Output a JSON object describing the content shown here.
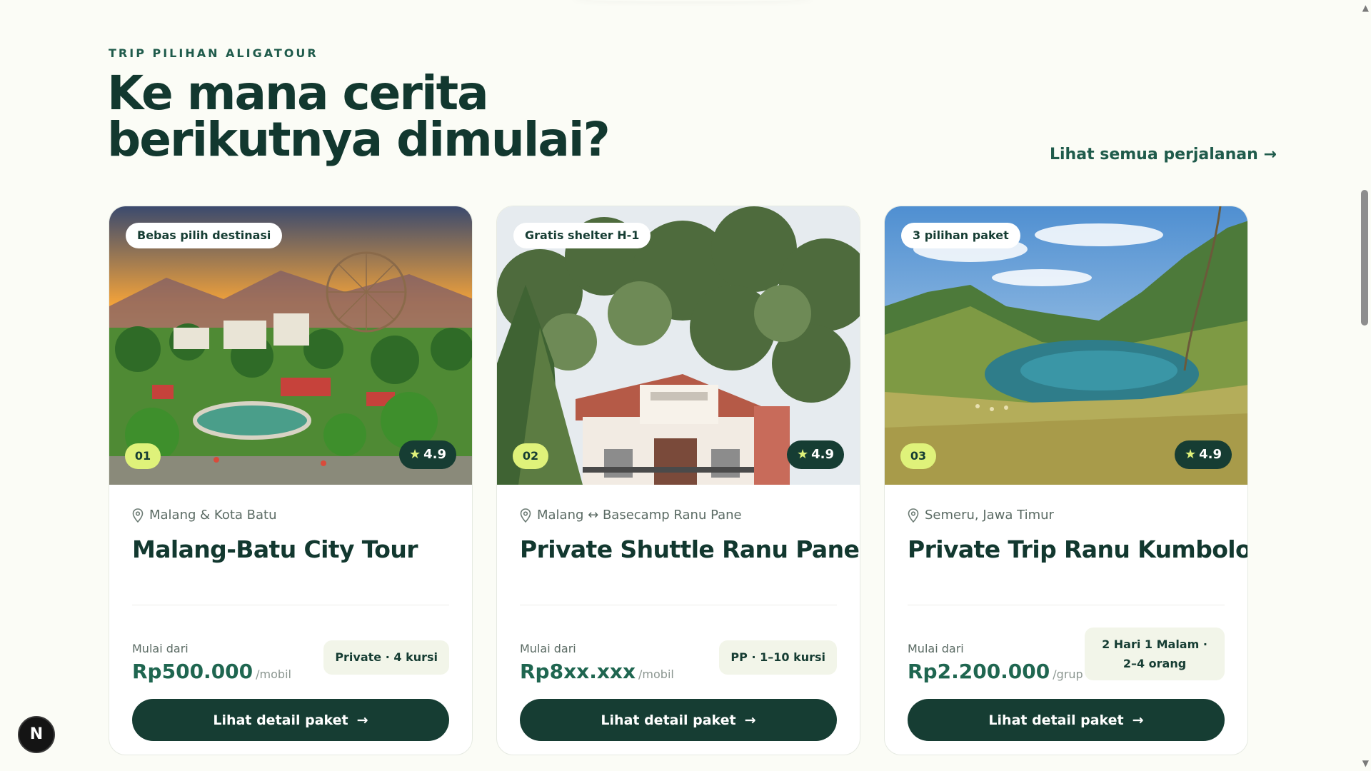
{
  "section": {
    "eyebrow": "TRIP PILIHAN ALIGATOUR",
    "headline_line1": "Ke mana cerita",
    "headline_line2": "berikutnya dimulai?",
    "see_all": "Lihat semua perjalanan →"
  },
  "cards": [
    {
      "tag": "Bebas pilih destinasi",
      "number": "01",
      "rating": "4.9",
      "location": "Malang & Kota Batu",
      "title": "Malang-Batu City Tour",
      "price_from": "Mulai dari",
      "price": "Rp500.000",
      "unit": "/mobil",
      "info": "Private · 4 kursi",
      "button": "Lihat detail paket"
    },
    {
      "tag": "Gratis shelter H-1",
      "number": "02",
      "rating": "4.9",
      "location": "Malang ↔ Basecamp Ranu Pane",
      "title": "Private Shuttle Ranu Pane",
      "price_from": "Mulai dari",
      "price": "Rp8xx.xxx",
      "unit": "/mobil",
      "info": "PP · 1–10 kursi",
      "button": "Lihat detail paket"
    },
    {
      "tag": "3 pilihan paket",
      "number": "03",
      "rating": "4.9",
      "location": "Semeru, Jawa Timur",
      "title": "Private Trip Ranu Kumbolo",
      "price_from": "Mulai dari",
      "price": "Rp2.200.000",
      "unit": "/grup",
      "info": "2 Hari 1 Malam · 2–4 orang",
      "button": "Lihat detail paket"
    }
  ],
  "floating_badge": "N",
  "icons": {
    "location": "map-pin-icon",
    "rating": "star-icon",
    "button_arrow": "arrow-right-icon"
  },
  "colors": {
    "background": "#fbfcf6",
    "primary": "#163d33",
    "accent_lime": "#dff27a",
    "price_green": "#1f6650"
  }
}
